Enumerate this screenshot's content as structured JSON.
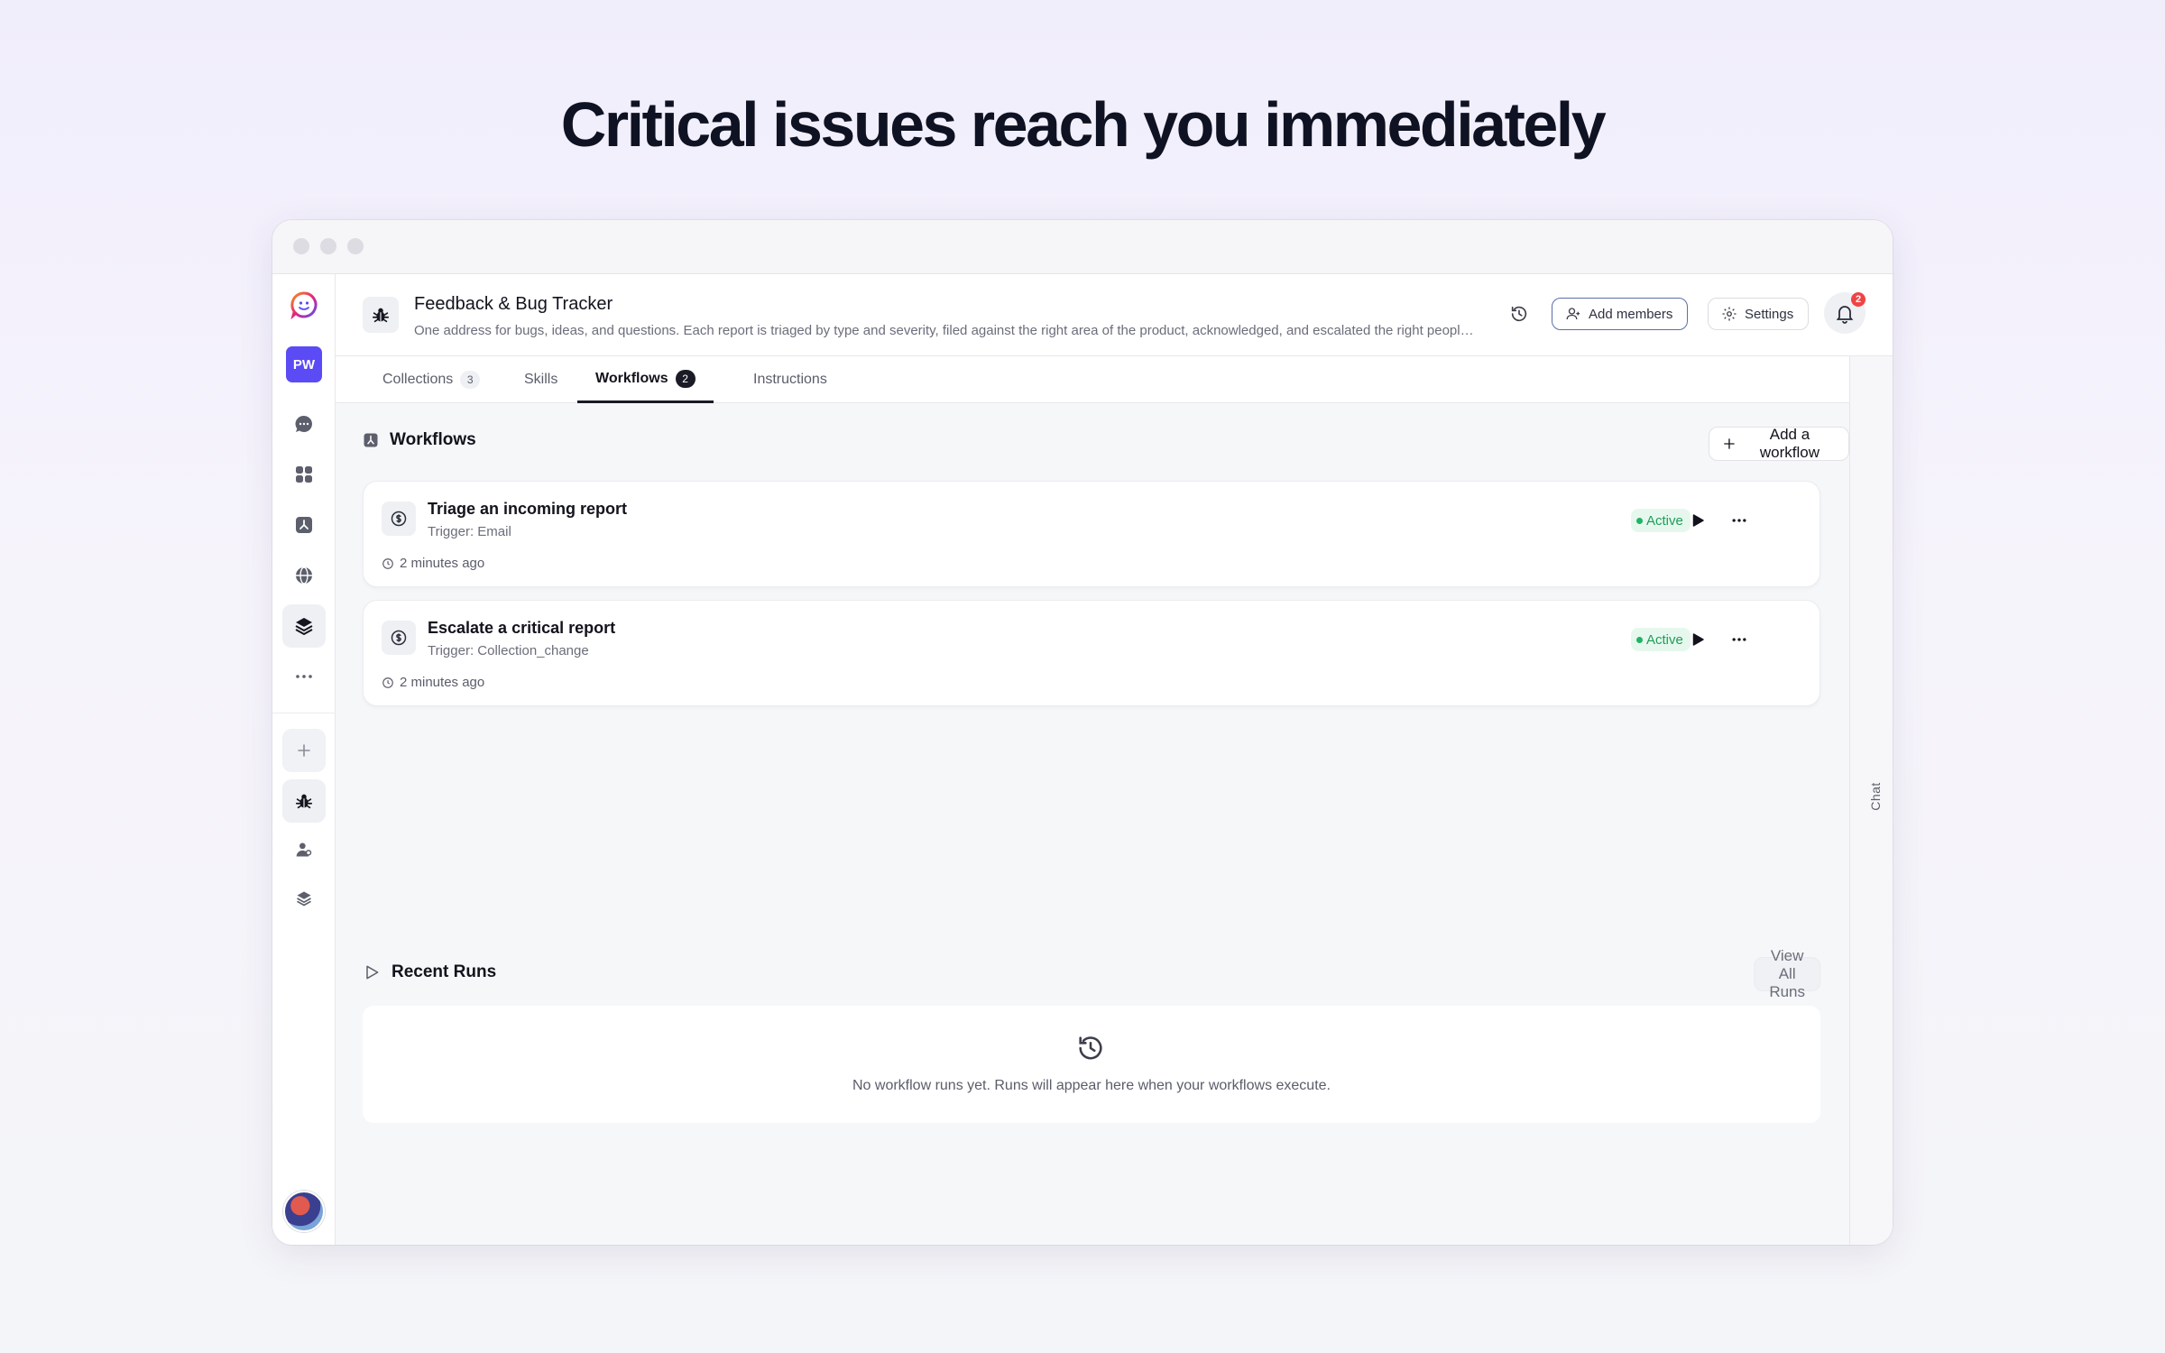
{
  "hero": {
    "title": "Critical issues reach you immediately"
  },
  "rail": {
    "workspace_initials": "PW",
    "icons": [
      "logo-icon",
      "chat-icon",
      "apps-icon",
      "workflows-icon",
      "globe-icon",
      "layers-icon",
      "more-icon",
      "add-icon",
      "bug-icon",
      "people-icon",
      "stack-icon"
    ]
  },
  "header": {
    "title": "Feedback & Bug Tracker",
    "description": "One address for bugs, ideas, and questions. Each report is triaged by type and severity, filed against the right area of the product, acknowledged, and escalated the right people immediately when something is critical.",
    "add_members_label": "Add members",
    "settings_label": "Settings",
    "notification_count": "2"
  },
  "tabs": [
    {
      "label": "Collections",
      "count": "3"
    },
    {
      "label": "Skills",
      "count": ""
    },
    {
      "label": "Workflows",
      "count": "2"
    },
    {
      "label": "Instructions",
      "count": ""
    }
  ],
  "active_tab": "Workflows",
  "workflows": {
    "heading": "Workflows",
    "add_label": "Add a workflow",
    "items": [
      {
        "title": "Triage an incoming report",
        "trigger": "Trigger: Email",
        "time": "2 minutes ago",
        "status": "Active"
      },
      {
        "title": "Escalate a critical report",
        "trigger": "Trigger: Collection_change",
        "time": "2 minutes ago",
        "status": "Active"
      }
    ]
  },
  "recent_runs": {
    "heading": "Recent Runs",
    "view_all_label": "View All Runs",
    "empty_text": "No workflow runs yet. Runs will appear here when your workflows execute."
  },
  "chat_panel": {
    "label": "Chat"
  },
  "colors": {
    "accent": "#5b4bf5",
    "active_green": "#1f9d57",
    "badge_red": "#ef4444"
  }
}
